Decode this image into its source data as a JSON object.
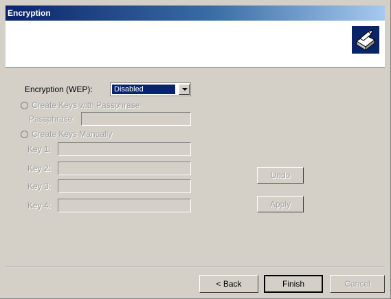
{
  "window": {
    "title": "Encryption"
  },
  "header": {
    "icon": "encryption-wizard-icon"
  },
  "form": {
    "encryption_label": "Encryption (WEP):",
    "encryption_value": "Disabled",
    "radio_passphrase_label": "Create Keys with Passphrase",
    "passphrase_label": "Passphrase:",
    "passphrase_value": "",
    "radio_manual_label": "Create Keys Manually",
    "keys": [
      {
        "label": "Key 1:",
        "value": ""
      },
      {
        "label": "Key 2:",
        "value": ""
      },
      {
        "label": "Key 3:",
        "value": ""
      },
      {
        "label": "Key 4:",
        "value": ""
      }
    ],
    "undo_label": "Undo",
    "apply_label": "Apply"
  },
  "footer": {
    "back_label": "< Back",
    "finish_label": "Finish",
    "cancel_label": "Cancel"
  }
}
